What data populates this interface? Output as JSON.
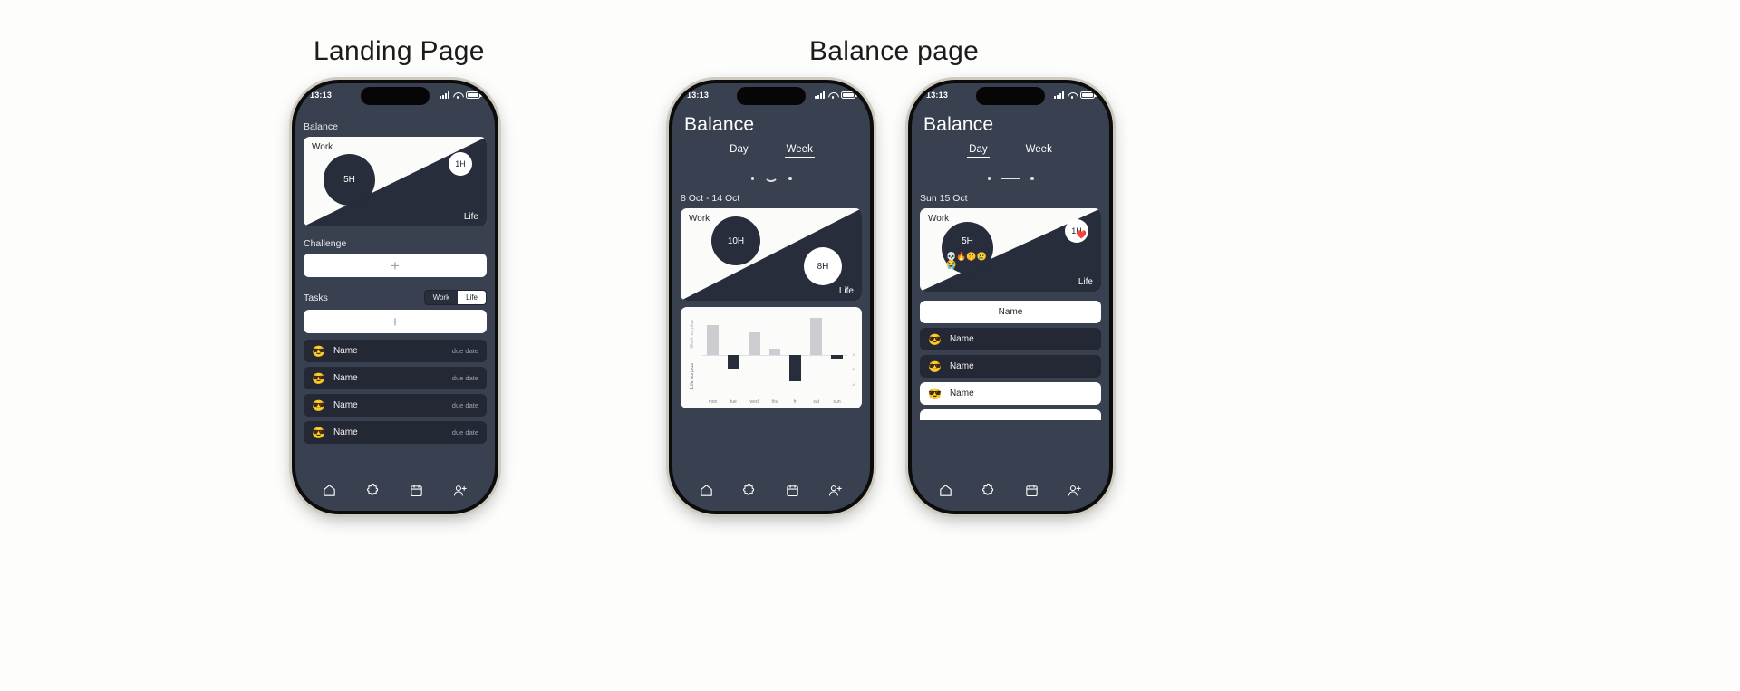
{
  "titles": {
    "landing": "Landing Page",
    "balance": "Balance page"
  },
  "status": {
    "time": "13:13"
  },
  "phone1": {
    "sections": {
      "balance": "Balance",
      "challenge": "Challenge",
      "tasks": "Tasks"
    },
    "balance_card": {
      "work_label": "Work",
      "life_label": "Life",
      "work_hours": "5H",
      "life_hours": "1H"
    },
    "add_label": "+",
    "toggle": {
      "work": "Work",
      "life": "Life",
      "active": "Life"
    },
    "tasks": [
      {
        "emoji": "😎",
        "name": "Name",
        "due": "due date"
      },
      {
        "emoji": "😎",
        "name": "Name",
        "due": "due date"
      },
      {
        "emoji": "😎",
        "name": "Name",
        "due": "due date"
      },
      {
        "emoji": "😎",
        "name": "Name",
        "due": "due date"
      }
    ]
  },
  "phone2": {
    "title": "Balance",
    "tabs": {
      "day": "Day",
      "week": "Week",
      "active": "Week"
    },
    "date_label": "8 Oct - 14 Oct",
    "balance_card": {
      "work_label": "Work",
      "life_label": "Life",
      "work_hours": "10H",
      "life_hours": "8H"
    },
    "chart_axis": {
      "top": "Work surplus",
      "bottom": "Life surplus"
    }
  },
  "phone3": {
    "title": "Balance",
    "tabs": {
      "day": "Day",
      "week": "Week",
      "active": "Day"
    },
    "date_label": "Sun 15 Oct",
    "balance_card": {
      "work_label": "Work",
      "life_label": "Life",
      "work_hours": "5H",
      "life_hours": "1H",
      "work_emojis": "💀🔥🤫😢😭",
      "life_emoji": "❤️"
    },
    "tasks": [
      {
        "emoji": "",
        "name": "Name",
        "style": "light"
      },
      {
        "emoji": "😎",
        "name": "Name",
        "style": "dark"
      },
      {
        "emoji": "😎",
        "name": "Name",
        "style": "dark"
      },
      {
        "emoji": "😎",
        "name": "Name",
        "style": "light"
      }
    ]
  },
  "nav": {
    "items": [
      {
        "icon": "home-icon",
        "active": true
      },
      {
        "icon": "puzzle-icon",
        "active": false
      },
      {
        "icon": "calendar-icon",
        "active": false
      },
      {
        "icon": "person-add-icon",
        "active": false
      }
    ]
  },
  "colors": {
    "screen_bg": "#39404f",
    "card_dark": "#272d3a",
    "card_light": "#fbfbfa",
    "row_dark": "#232834",
    "bar_positive": "#cccdd0",
    "bar_negative": "#272d3a",
    "page_bg": "#fdfdfc"
  },
  "chart_data": {
    "type": "bar",
    "title": "",
    "categories": [
      "mon",
      "tue",
      "wed",
      "thu",
      "fri",
      "sat",
      "sun"
    ],
    "values": [
      3.0,
      -1.3,
      2.3,
      0.6,
      -2.6,
      3.8,
      -0.35
    ],
    "series": [
      {
        "name": "Work surplus",
        "values": [
          3.0,
          0,
          2.3,
          0.6,
          0,
          3.8,
          0
        ]
      },
      {
        "name": "Life surplus",
        "values": [
          0,
          -1.3,
          0,
          0,
          -2.6,
          0,
          -0.35
        ]
      }
    ],
    "xlabel": "",
    "ylabel": "Work surplus / Life surplus",
    "ylim": [
      -3.2,
      4.2
    ],
    "grid": false,
    "legend_position": "none",
    "y_axis_top_label": "Work surplus",
    "y_axis_bottom_label": "Life surplus"
  }
}
